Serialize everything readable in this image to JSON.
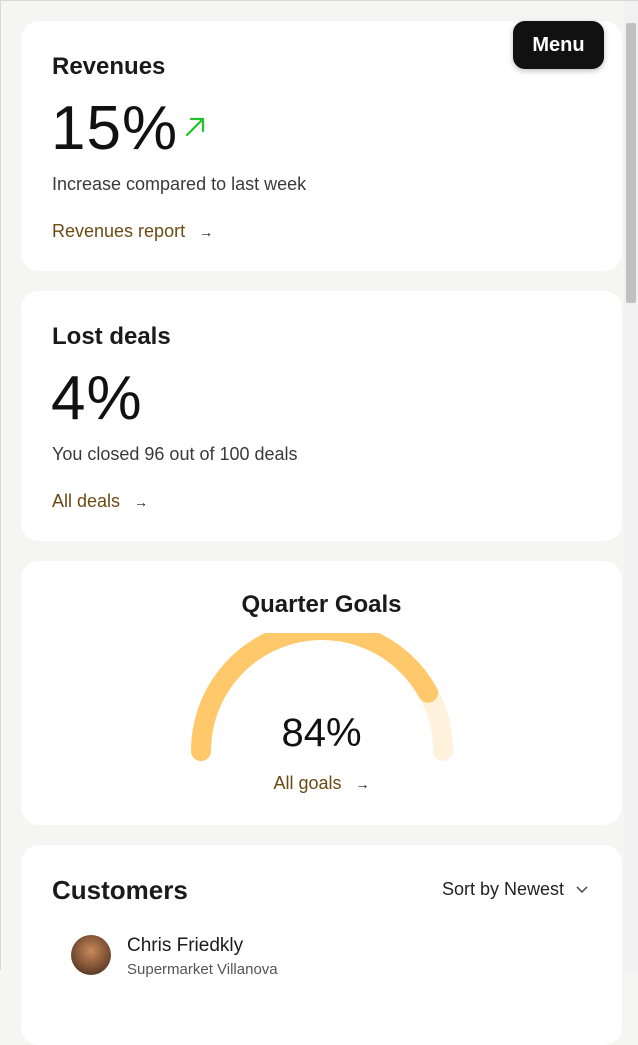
{
  "menu": {
    "label": "Menu"
  },
  "revenues": {
    "title": "Revenues",
    "value": "15%",
    "description": "Increase compared to last week",
    "link": "Revenues report",
    "trend_icon": "arrow-up-right-icon",
    "trend_color": "#22c32a"
  },
  "lost_deals": {
    "title": "Lost deals",
    "value": "4%",
    "description": "You closed 96 out of 100 deals",
    "link": "All deals"
  },
  "goals": {
    "title": "Quarter Goals",
    "value": "84%",
    "progress": 0.84,
    "link": "All goals",
    "fill_color": "#ffc96b",
    "track_color": "#fff2dc"
  },
  "customers": {
    "title": "Customers",
    "sort_label": "Sort by Newest",
    "items": [
      {
        "name": "Chris Friedkly",
        "company": "Supermarket Villanova"
      }
    ]
  },
  "arrow_glyph": "→",
  "chevron_glyph": "⌄"
}
